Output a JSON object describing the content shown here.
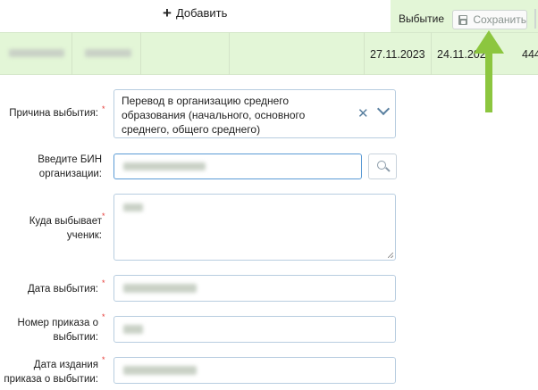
{
  "toolbar": {
    "add_label": "Добавить"
  },
  "tab": {
    "label": "Выбытие",
    "save_label": "Сохранить"
  },
  "row": {
    "date1": "27.11.2023",
    "date2": "24.11.202",
    "cut": "444"
  },
  "form": {
    "reason": {
      "label": "Причина выбытия:",
      "value": "Перевод в организацию среднего образования (начального, основного среднего, общего среднего)"
    },
    "bin": {
      "label_line1": "Введите БИН",
      "label_line2": "организации:"
    },
    "where": {
      "label_line1": "Куда выбывает",
      "label_line2": "ученик:"
    },
    "date": {
      "label": "Дата выбытия:"
    },
    "order_number": {
      "label_line1": "Номер приказа о",
      "label_line2": "выбытии:"
    },
    "order_date": {
      "label_line1": "Дата издания",
      "label_line2": "приказа о выбытии:"
    }
  },
  "colors": {
    "accent_green": "#8cc63f",
    "row_bg": "#e3f6d7",
    "required": "#e53935"
  }
}
